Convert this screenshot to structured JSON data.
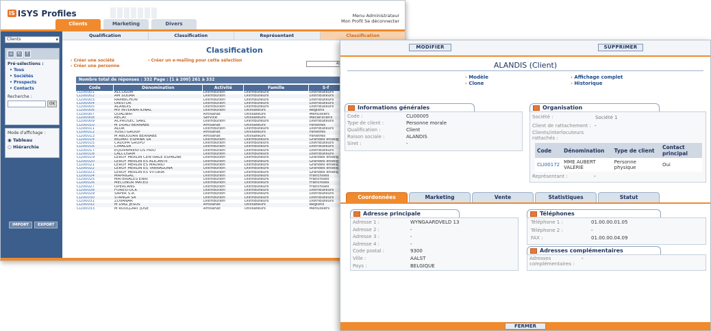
{
  "back": {
    "logo": "ISYS Profiles",
    "top_tabs": [
      "Clients",
      "Marketing",
      "Divers"
    ],
    "user_menu": "Menu Administrateur",
    "user_links": "Mon Profil  Se déconnecter",
    "client_select": "Clients",
    "preselection_title": "Pré-sélections :",
    "preselections": [
      "Tous",
      "Sociétés",
      "Prospects",
      "Contacts"
    ],
    "search_label": "Recherche :",
    "search_button": "OK",
    "display_mode_label": "Mode d'affichage :",
    "display_modes": [
      "Tableau",
      "Hiérarchie"
    ],
    "import_button": "IMPORT",
    "export_button": "EXPORT",
    "sub_tabs": [
      "Qualification",
      "Classification",
      "Représentant",
      "Classification"
    ],
    "title": "Classification",
    "actions": [
      "Créer une société",
      "Créer une personne",
      "Créer un e-mailing pour cette sélection"
    ],
    "filter_button": "Ajout",
    "count_bar": "Nombre total de réponses : 332       Page : [1 à 200]  261 à 332",
    "columns": [
      "Code",
      "Dénomination",
      "Activité",
      "Famille",
      "S-f"
    ],
    "rows": [
      [
        "CLI00001",
        "ALCOSUM",
        "Distribution",
        "Distributeurs",
        "Distributeurs"
      ],
      [
        "CLI00002",
        "AM SODAR",
        "Distribution",
        "Distributeurs",
        "Distributeurs"
      ],
      [
        "CLI00003",
        "RAMBICHON",
        "Distribution",
        "Distributeurs",
        "Distributeurs"
      ],
      [
        "CLI00004",
        "UNISTOR",
        "Distribution",
        "Distributeurs",
        "Distributeurs"
      ],
      [
        "CLI00005",
        "ALANDIS",
        "Distribution",
        "Distributeurs",
        "Distributeurs"
      ],
      [
        "CLI00006",
        "MV INTERNATIONAL",
        "Distribution",
        "Utilisateurs",
        "Regions"
      ],
      [
        "CLI00007",
        "QUALIBAT",
        "Artisanat",
        "Utilisateurs",
        "Menuisiers"
      ],
      [
        "CLI00008",
        "RECAT",
        "Service",
        "Utilisateurs",
        "Mécaniciens"
      ],
      [
        "CLI00009",
        "ACPROSEC SARL",
        "Distribution",
        "Distributeurs",
        "Distributeurs"
      ],
      [
        "CLI00010",
        "M DUALI BERNABE",
        "Artisanat",
        "Utilisateurs",
        "Fenêtres"
      ],
      [
        "CLI00011",
        "ALOA",
        "Distribution",
        "Distributeurs",
        "Distributeurs"
      ],
      [
        "CLI00012",
        "YOSCI GROUP",
        "Artisanat",
        "Utilisateurs",
        "Fenêtres"
      ],
      [
        "CLI00013",
        "M ABOUDAN BERNABE",
        "Artisanat",
        "Utilisateurs",
        "Fenêtres"
      ],
      [
        "CLI00014",
        "BIGMAT ESPANA SA",
        "Distribution",
        "Distributeurs",
        "Grandes enseig"
      ],
      [
        "CLI00015",
        "CADUPA GRUPO",
        "Distribution",
        "Distributeurs",
        "Distributeurs"
      ],
      [
        "CLI00016",
        "CIMALSA",
        "Distribution",
        "Distributeurs",
        "Distributeurs"
      ],
      [
        "CLI00017",
        "EQUIPAMIENTOS PRIO",
        "Distribution",
        "Distributeurs",
        "Distributeurs"
      ],
      [
        "CLI00018",
        "LALCOSAM",
        "Distribution",
        "Distributeurs",
        "Distributeurs"
      ],
      [
        "CLI00019",
        "LEROY MERLIN CENTRALE ESPAGNE",
        "Distribution",
        "Distributeurs",
        "Grandes enseig"
      ],
      [
        "CLI00020",
        "LEROY MERLIN ES ALICANTE",
        "Distribution",
        "Distributeurs",
        "Grandes enseig"
      ],
      [
        "CLI00021",
        "LEROY MERLIN ES MADRID",
        "Distribution",
        "Distributeurs",
        "Grandes enseig"
      ],
      [
        "CLI00022",
        "LEROY MERLIN ES TARRAGONA",
        "Distribution",
        "Distributeurs",
        "Grandes enseig"
      ],
      [
        "CLI00023",
        "LEROY MERLIN ES VITORIA",
        "Distribution",
        "Distributeurs",
        "Grandes enseig"
      ],
      [
        "CLI00024",
        "MAPRIGAL",
        "Distribution",
        "Distributeurs",
        "Franchises"
      ],
      [
        "CLI00025",
        "MATERIALES ENRI",
        "Distribution",
        "Distributeurs",
        "Franchises"
      ],
      [
        "CLI00026",
        "MECONOR MATEU",
        "Distribution",
        "Distributeurs",
        "Franchises"
      ],
      [
        "CLI00027",
        "OPERCANS",
        "Distribution",
        "Distributeurs",
        "Franchises"
      ],
      [
        "CLI00028",
        "FORESTOCK",
        "Distribution",
        "Distributeurs",
        "Distributeurs"
      ],
      [
        "CLI00029",
        "SAPER S.A.",
        "Distribution",
        "Distributeurs",
        "Distributeurs"
      ],
      [
        "CLI00030",
        "STANGA SA",
        "Distribution",
        "Distributeurs",
        "Distributeurs"
      ],
      [
        "CLI00031",
        "ZOVANAR",
        "Distribution",
        "Distributeurs",
        "Distributeurs"
      ],
      [
        "CLI00032",
        "M DIAZ JESUS",
        "Artisanat",
        "Utilisateurs",
        "Regions"
      ],
      [
        "CLI00033",
        "M ROULLART JOSE",
        "Artisanat",
        "Utilisateurs",
        "Menuisiers"
      ]
    ]
  },
  "front": {
    "modify_button": "MODIFIER",
    "delete_button": "SUPPRIMER",
    "close_button": "FERMER",
    "title": "ALANDIS (Client)",
    "links": [
      "Modèle",
      "Clone",
      "Affichage complet",
      "Historique"
    ],
    "general": {
      "heading": "Informations générales",
      "fields": [
        {
          "label": "Code :",
          "value": "CLI00005"
        },
        {
          "label": "Type de client :",
          "value": "Personne morale"
        },
        {
          "label": "Qualification :",
          "value": "Client"
        },
        {
          "label": "Raison sociale :",
          "value": "ALANDIS"
        },
        {
          "label": "Siret :",
          "value": "-"
        }
      ]
    },
    "organisation": {
      "heading": "Organisation",
      "societe_label": "Société :",
      "societe_value": "Société 1",
      "rattachement_label": "Client de rattachement :",
      "rattachement_value": "-",
      "clients_label": "Clients/interlocuteurs rattachés :",
      "table_headers": [
        "Code",
        "Dénomination",
        "Type de client",
        "Contact principal"
      ],
      "table_row": [
        "CLI00172",
        "MME AUBERT VALERIE",
        "Personne physique",
        "Oui"
      ],
      "representant_label": "Représentant :",
      "representant_value": "-"
    },
    "tabs": [
      "Coordonnées",
      "Marketing",
      "Vente",
      "Statistiques",
      "Statut"
    ],
    "address": {
      "heading": "Adresse principale",
      "fields": [
        {
          "label": "Adresse 1 :",
          "value": "WYNGAARDVELD 13"
        },
        {
          "label": "Adresse 2 :",
          "value": "-"
        },
        {
          "label": "Adresse 3 :",
          "value": "-"
        },
        {
          "label": "Adresse 4 :",
          "value": "-"
        },
        {
          "label": "Code postal :",
          "value": "9300"
        },
        {
          "label": "Ville :",
          "value": "AALST"
        },
        {
          "label": "Pays :",
          "value": "BELGIQUE"
        }
      ]
    },
    "phones": {
      "heading": "Téléphones",
      "fields": [
        {
          "label": "Téléphone 1 :",
          "value": "01.00.00.01.05"
        },
        {
          "label": "Téléphone 2 :",
          "value": "-"
        },
        {
          "label": "FAX :",
          "value": "01.00.00.04.09"
        }
      ]
    },
    "extra_addresses": {
      "heading": "Adresses complémentaires",
      "label": "Adresses complémentaires :",
      "value": "-"
    }
  }
}
